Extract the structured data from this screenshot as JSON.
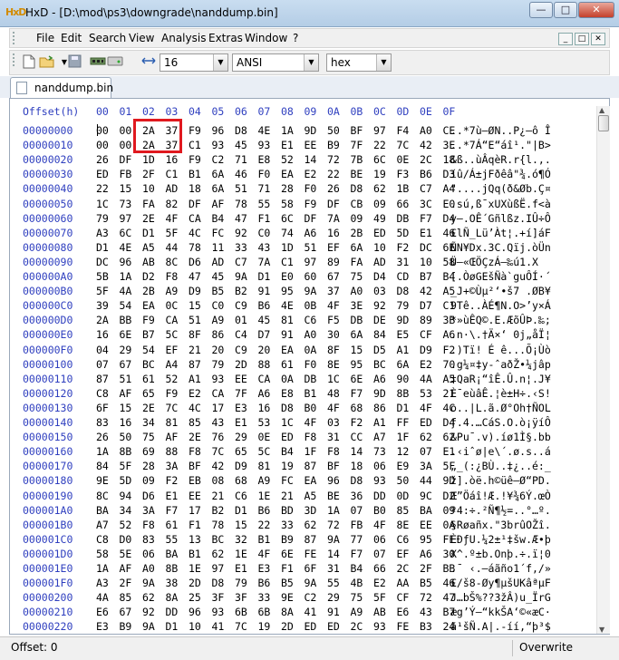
{
  "window": {
    "title": "HxD - [D:\\mod\\ps3\\downgrade\\nanddump.bin]",
    "app_icon": "HxD",
    "min_label": "—",
    "max_label": "□",
    "close_label": "✕"
  },
  "menu": {
    "items": [
      "File",
      "Edit",
      "Search",
      "View",
      "Analysis",
      "Extras",
      "Window",
      "?"
    ],
    "mdi": {
      "min": "_",
      "restore": "□",
      "close": "✕"
    }
  },
  "toolbar": {
    "bytes_per_row": "16",
    "charset": "ANSI",
    "number_base": "hex",
    "icons": [
      "new-file-icon",
      "open-folder-icon",
      "save-icon",
      "ram-icon",
      "disk-icon",
      "columns-icon"
    ]
  },
  "tab": {
    "label": "nanddump.bin"
  },
  "editor": {
    "offset_header": "Offset(h)",
    "columns": [
      "00",
      "01",
      "02",
      "03",
      "04",
      "05",
      "06",
      "07",
      "08",
      "09",
      "0A",
      "0B",
      "0C",
      "0D",
      "0E",
      "0F"
    ],
    "rows": [
      {
        "offset": "00000000",
        "bytes": [
          "00",
          "00",
          "2A",
          "37",
          "F9",
          "96",
          "D8",
          "4E",
          "1A",
          "9D",
          "50",
          "BF",
          "97",
          "F4",
          "A0",
          "CE"
        ],
        "ascii": "..*7ù–ØN..P¿—ô Î"
      },
      {
        "offset": "00000010",
        "bytes": [
          "00",
          "00",
          "2A",
          "37",
          "C1",
          "93",
          "45",
          "93",
          "E1",
          "EE",
          "B9",
          "7F",
          "22",
          "7C",
          "42",
          "3E"
        ],
        "ascii": "..*7Á“E“áî¹.\"|B>"
      },
      {
        "offset": "00000020",
        "bytes": [
          "26",
          "DF",
          "1D",
          "16",
          "F9",
          "C2",
          "71",
          "E8",
          "52",
          "14",
          "72",
          "7B",
          "6C",
          "0E",
          "2C",
          "18"
        ],
        "ascii": "&ß..ùÂqèR.r{l.,."
      },
      {
        "offset": "00000030",
        "bytes": [
          "ED",
          "FB",
          "2F",
          "C1",
          "B1",
          "6A",
          "46",
          "F0",
          "EA",
          "E2",
          "22",
          "BE",
          "19",
          "F3",
          "B6",
          "D3"
        ],
        "ascii": "íû/Á±jFðêâ\"¾.ó¶Ó"
      },
      {
        "offset": "00000040",
        "bytes": [
          "22",
          "15",
          "10",
          "AD",
          "18",
          "6A",
          "51",
          "71",
          "28",
          "F0",
          "26",
          "D8",
          "62",
          "1B",
          "C7",
          "A4"
        ],
        "ascii": "\"...­.jQq(ð&Øb.Ç¤"
      },
      {
        "offset": "00000050",
        "bytes": [
          "1C",
          "73",
          "FA",
          "82",
          "DF",
          "AF",
          "78",
          "55",
          "58",
          "F9",
          "DF",
          "CB",
          "09",
          "66",
          "3C",
          "E0"
        ],
        "ascii": ".sú‚ß¯xUXùßË.f<à"
      },
      {
        "offset": "00000060",
        "bytes": [
          "79",
          "97",
          "2E",
          "4F",
          "CA",
          "B4",
          "47",
          "F1",
          "6C",
          "DF",
          "7A",
          "09",
          "49",
          "DB",
          "F7",
          "D4"
        ],
        "ascii": "y—.OÊ´Gñlßz.IÛ÷Ô"
      },
      {
        "offset": "00000070",
        "bytes": [
          "A3",
          "6C",
          "D1",
          "5F",
          "4C",
          "FC",
          "92",
          "C0",
          "74",
          "A6",
          "16",
          "2B",
          "ED",
          "5D",
          "E1",
          "46"
        ],
        "ascii": "£lÑ_Lü’Àt¦.+í]áF"
      },
      {
        "offset": "00000080",
        "bytes": [
          "D1",
          "4E",
          "A5",
          "44",
          "78",
          "11",
          "33",
          "43",
          "1D",
          "51",
          "EF",
          "6A",
          "10",
          "F2",
          "DC",
          "6E"
        ],
        "ascii": "ÑN¥Dx.3C.Qïj.òÜn"
      },
      {
        "offset": "00000090",
        "bytes": [
          "DC",
          "96",
          "AB",
          "8C",
          "D6",
          "AD",
          "C7",
          "7A",
          "C1",
          "97",
          "89",
          "FA",
          "AD",
          "31",
          "10",
          "58"
        ],
        "ascii": "Ü–«ŒÖ­ÇzÁ—‰ú­1.X"
      },
      {
        "offset": "000000A0",
        "bytes": [
          "5B",
          "1A",
          "D2",
          "F8",
          "47",
          "45",
          "9A",
          "D1",
          "E0",
          "60",
          "67",
          "75",
          "D4",
          "CD",
          "B7",
          "B4"
        ],
        "ascii": "[.ÒøGEšÑà`guÔÍ·´"
      },
      {
        "offset": "000000B0",
        "bytes": [
          "5F",
          "4A",
          "2B",
          "A9",
          "D9",
          "B5",
          "B2",
          "91",
          "95",
          "9A",
          "37",
          "A0",
          "03",
          "D8",
          "42",
          "A5"
        ],
        "ascii": "_J+©Ùµ²‘•š7 .ØB¥"
      },
      {
        "offset": "000000C0",
        "bytes": [
          "39",
          "54",
          "EA",
          "0C",
          "15",
          "C0",
          "C9",
          "B6",
          "4E",
          "0B",
          "4F",
          "3E",
          "92",
          "79",
          "D7",
          "C1"
        ],
        "ascii": "9Tê..ÀÉ¶N.O>’y×Á"
      },
      {
        "offset": "000000D0",
        "bytes": [
          "2A",
          "BB",
          "F9",
          "CA",
          "51",
          "A9",
          "01",
          "45",
          "81",
          "C6",
          "F5",
          "DB",
          "DE",
          "9D",
          "89",
          "3B"
        ],
        "ascii": "*»ùÊQ©.E.ÆõÛÞ.‰;"
      },
      {
        "offset": "000000E0",
        "bytes": [
          "16",
          "6E",
          "B7",
          "5C",
          "8F",
          "86",
          "C4",
          "D7",
          "91",
          "A0",
          "30",
          "6A",
          "84",
          "E5",
          "CF",
          "A6"
        ],
        "ascii": ".n·\\.†Ä×‘ 0j„åÏ¦"
      },
      {
        "offset": "000000F0",
        "bytes": [
          "04",
          "29",
          "54",
          "EF",
          "21",
          "20",
          "C9",
          "20",
          "EA",
          "0A",
          "8F",
          "15",
          "D5",
          "A1",
          "D9",
          "F2"
        ],
        "ascii": ".)Tï! É ê...Õ¡Ùò"
      },
      {
        "offset": "00000100",
        "bytes": [
          "07",
          "67",
          "BC",
          "A4",
          "87",
          "79",
          "2D",
          "88",
          "61",
          "F0",
          "8E",
          "95",
          "BC",
          "6A",
          "E2",
          "70"
        ],
        "ascii": ".g¼¤‡y-ˆaðŽ•¼jâp"
      },
      {
        "offset": "00000110",
        "bytes": [
          "87",
          "51",
          "61",
          "52",
          "A1",
          "93",
          "EE",
          "CA",
          "0A",
          "DB",
          "1C",
          "6E",
          "A6",
          "90",
          "4A",
          "A5"
        ],
        "ascii": "‡QaR¡“îÊ.Û.n¦.J¥"
      },
      {
        "offset": "00000120",
        "bytes": [
          "C8",
          "AF",
          "65",
          "F9",
          "E2",
          "CA",
          "7F",
          "A6",
          "E8",
          "B1",
          "48",
          "F7",
          "9D",
          "8B",
          "53",
          "21"
        ],
        "ascii": "È¯eùâÊ.¦è±H÷.‹S!"
      },
      {
        "offset": "00000130",
        "bytes": [
          "6F",
          "15",
          "2E",
          "7C",
          "4C",
          "17",
          "E3",
          "16",
          "D8",
          "B0",
          "4F",
          "68",
          "86",
          "D1",
          "4F",
          "4C"
        ],
        "ascii": "o..|L.ã.Ø°Oh†ÑOL"
      },
      {
        "offset": "00000140",
        "bytes": [
          "83",
          "16",
          "34",
          "81",
          "85",
          "43",
          "E1",
          "53",
          "1C",
          "4F",
          "03",
          "F2",
          "A1",
          "FF",
          "ED",
          "D4"
        ],
        "ascii": "ƒ.4.…CáS.O.ò¡ÿíÔ"
      },
      {
        "offset": "00000150",
        "bytes": [
          "26",
          "50",
          "75",
          "AF",
          "2E",
          "76",
          "29",
          "0E",
          "ED",
          "F8",
          "31",
          "CC",
          "A7",
          "1F",
          "62",
          "62"
        ],
        "ascii": "&Pu¯.v).íø1Ì§.bb"
      },
      {
        "offset": "00000160",
        "bytes": [
          "1A",
          "8B",
          "69",
          "88",
          "F8",
          "7C",
          "65",
          "5C",
          "B4",
          "1F",
          "F8",
          "14",
          "73",
          "12",
          "07",
          "E1"
        ],
        "ascii": ".‹iˆø|e\\´.ø.s..á"
      },
      {
        "offset": "00000170",
        "bytes": [
          "84",
          "5F",
          "28",
          "3A",
          "BF",
          "42",
          "D9",
          "81",
          "19",
          "87",
          "BF",
          "18",
          "06",
          "E9",
          "3A",
          "5F"
        ],
        "ascii": "„_(:¿BÙ..‡¿..é:_"
      },
      {
        "offset": "00000180",
        "bytes": [
          "9E",
          "5D",
          "09",
          "F2",
          "EB",
          "08",
          "68",
          "A9",
          "FC",
          "EA",
          "96",
          "D8",
          "93",
          "50",
          "44",
          "9D"
        ],
        "ascii": "ž].òë.h©üê–Ø“PD."
      },
      {
        "offset": "00000190",
        "bytes": [
          "8C",
          "94",
          "D6",
          "E1",
          "EE",
          "21",
          "C6",
          "1E",
          "21",
          "A5",
          "BE",
          "36",
          "DD",
          "0D",
          "9C",
          "D2"
        ],
        "ascii": "Œ”Öáî!Æ.!¥¾6Ý.œÒ"
      },
      {
        "offset": "000001A0",
        "bytes": [
          "BA",
          "34",
          "3A",
          "F7",
          "17",
          "B2",
          "D1",
          "B6",
          "BD",
          "3D",
          "1A",
          "07",
          "B0",
          "85",
          "BA",
          "09"
        ],
        "ascii": "º4:÷.²Ñ¶½=..°…º."
      },
      {
        "offset": "000001B0",
        "bytes": [
          "A7",
          "52",
          "F8",
          "61",
          "F1",
          "78",
          "15",
          "22",
          "33",
          "62",
          "72",
          "FB",
          "4F",
          "8E",
          "EE",
          "0A"
        ],
        "ascii": "§Røañx.\"3brûOŽî."
      },
      {
        "offset": "000001C0",
        "bytes": [
          "C8",
          "D0",
          "83",
          "55",
          "13",
          "BC",
          "32",
          "B1",
          "B9",
          "87",
          "9A",
          "77",
          "06",
          "C6",
          "95",
          "FE"
        ],
        "ascii": "ÈÐƒU.¼2±¹‡šw.Æ•þ"
      },
      {
        "offset": "000001D0",
        "bytes": [
          "58",
          "5E",
          "06",
          "BA",
          "B1",
          "62",
          "1E",
          "4F",
          "6E",
          "FE",
          "14",
          "F7",
          "07",
          "EF",
          "A6",
          "30"
        ],
        "ascii": "X^.º±b.Onþ.÷.ï¦0"
      },
      {
        "offset": "000001E0",
        "bytes": [
          "1A",
          "AF",
          "A0",
          "8B",
          "1E",
          "97",
          "E1",
          "E3",
          "F1",
          "6F",
          "31",
          "B4",
          "66",
          "2C",
          "2F",
          "BB"
        ],
        "ascii": ".¯ ‹.—áãño1´f,/»"
      },
      {
        "offset": "000001F0",
        "bytes": [
          "A3",
          "2F",
          "9A",
          "38",
          "2D",
          "D8",
          "79",
          "B6",
          "B5",
          "9A",
          "55",
          "4B",
          "E2",
          "AA",
          "B5",
          "46"
        ],
        "ascii": "£/š8-Øy¶µšUKâªµF"
      },
      {
        "offset": "00000200",
        "bytes": [
          "4A",
          "85",
          "62",
          "8A",
          "25",
          "3F",
          "3F",
          "33",
          "9E",
          "C2",
          "29",
          "75",
          "5F",
          "CF",
          "72",
          "47"
        ],
        "ascii": "J…bŠ%??3žÂ)u_ÏrG"
      },
      {
        "offset": "00000210",
        "bytes": [
          "E6",
          "67",
          "92",
          "DD",
          "96",
          "93",
          "6B",
          "6B",
          "8A",
          "41",
          "91",
          "A9",
          "AB",
          "E6",
          "43",
          "B7"
        ],
        "ascii": "æg’Ý–“kkŠA‘©«æC·"
      },
      {
        "offset": "00000220",
        "bytes": [
          "E3",
          "B9",
          "9A",
          "D1",
          "10",
          "41",
          "7C",
          "19",
          "2D",
          "ED",
          "ED",
          "2C",
          "93",
          "FE",
          "B3",
          "24"
        ],
        "ascii": "ã¹šÑ.A|.-íí,“þ³$"
      }
    ]
  },
  "status": {
    "offset_label": "Offset: 0",
    "mode": "Overwrite"
  }
}
